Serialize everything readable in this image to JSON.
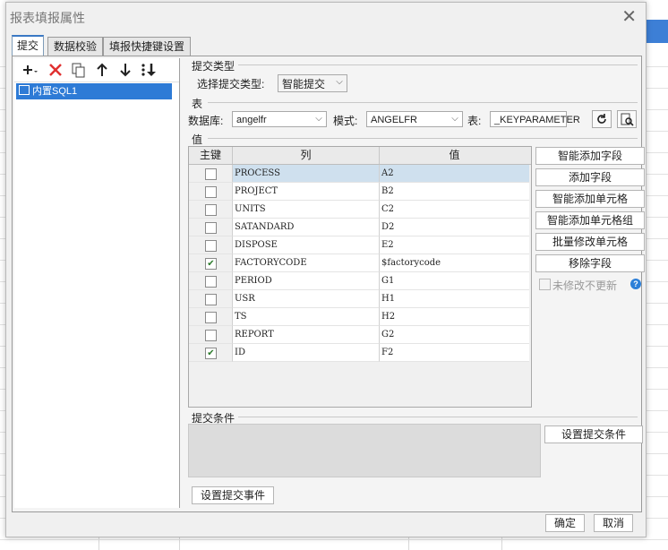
{
  "dialog": {
    "title": "报表填报属性",
    "close_glyph": "✕",
    "tabs": [
      "提交",
      "数据校验",
      "填报快捷键设置"
    ],
    "ok_label": "确定",
    "cancel_label": "取消"
  },
  "left": {
    "toolbar_icons": [
      "add-icon",
      "delete-icon",
      "copy-icon",
      "arrow-up-icon",
      "arrow-down-icon",
      "sort-icon"
    ],
    "tree_item": "内置SQL1"
  },
  "submit_type": {
    "section_label": "提交类型",
    "field_label": "选择提交类型:",
    "value": "智能提交"
  },
  "table_section": {
    "section_label": "表",
    "db_label": "数据库:",
    "db_value": "angelfr",
    "schema_label": "模式:",
    "schema_value": "ANGELFR",
    "table_label": "表:",
    "table_value": "_KEYPARAMETER"
  },
  "values_section": {
    "section_label": "值",
    "columns": [
      "主键",
      "列",
      "值"
    ],
    "rows": [
      {
        "key": false,
        "column": "PROCESS",
        "value": "A2",
        "selected": true
      },
      {
        "key": false,
        "column": "PROJECT",
        "value": "B2"
      },
      {
        "key": false,
        "column": "UNITS",
        "value": "C2"
      },
      {
        "key": false,
        "column": "SATANDARD",
        "value": "D2"
      },
      {
        "key": false,
        "column": "DISPOSE",
        "value": "E2"
      },
      {
        "key": true,
        "column": "FACTORYCODE",
        "value": "$factorycode"
      },
      {
        "key": false,
        "column": "PERIOD",
        "value": "G1"
      },
      {
        "key": false,
        "column": "USR",
        "value": "H1"
      },
      {
        "key": false,
        "column": "TS",
        "value": "H2"
      },
      {
        "key": false,
        "column": "REPORT",
        "value": "G2"
      },
      {
        "key": true,
        "column": "ID",
        "value": "F2"
      }
    ],
    "buttons": [
      "智能添加字段",
      "添加字段",
      "智能添加单元格",
      "智能添加单元格组",
      "批量修改单元格",
      "移除字段"
    ],
    "unmodified_label": "未修改不更新"
  },
  "condition_section": {
    "section_label": "提交条件",
    "set_condition_label": "设置提交条件",
    "set_event_label": "设置提交事件"
  }
}
